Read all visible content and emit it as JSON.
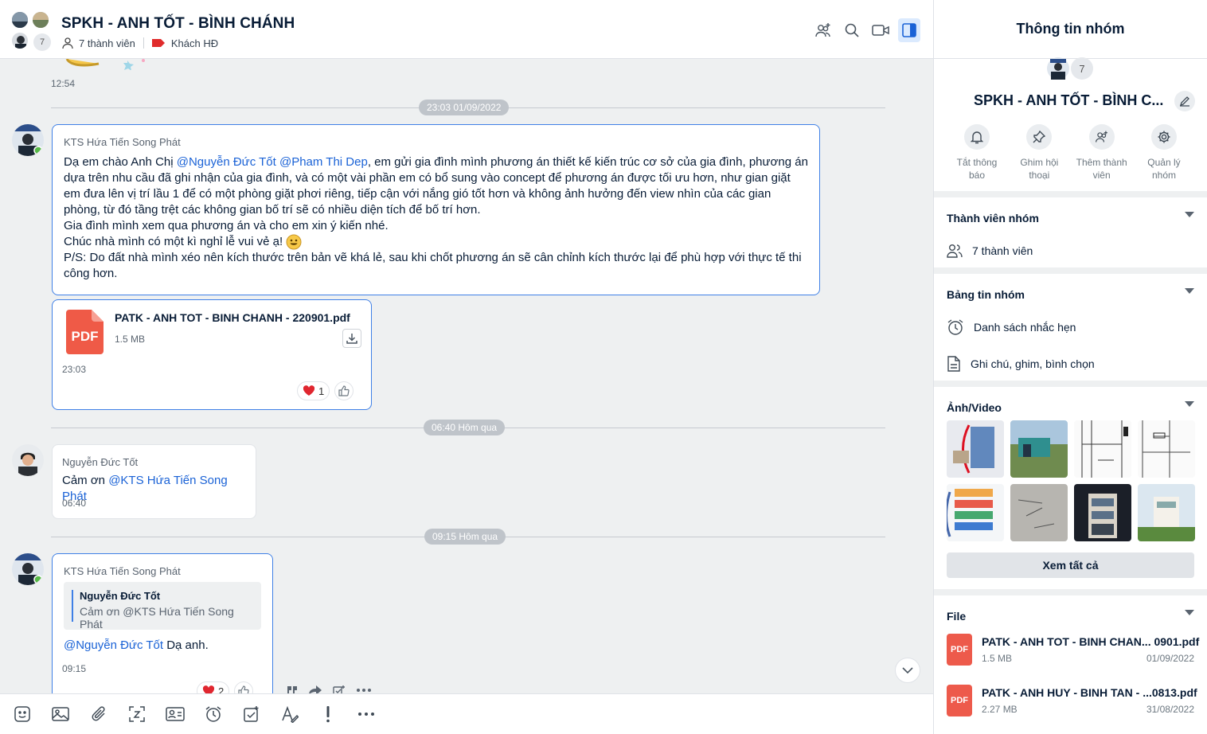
{
  "header": {
    "title": "SPKH - ANH TỐT - BÌNH CHÁNH",
    "member_count_badge": "7",
    "members_label": "7 thành viên",
    "tag_label": "Khách HĐ",
    "tag_color": "#e02b2b",
    "icons": [
      "add-member-icon",
      "search-icon",
      "video-call-icon",
      "toggle-info-panel-icon"
    ]
  },
  "chat": {
    "prev_message_time": "12:54",
    "messages": [
      {
        "separator": "23:03 01/09/2022",
        "sender": "KTS Hứa Tiến Song Phát",
        "text_intro": "Dạ em chào Anh Chị ",
        "mention1": "@Nguyễn Đức Tốt",
        "mention2": "@Pham Thi Dep",
        "text_body": ", em gửi gia đình mình phương án thiết kế kiến trúc cơ sở của gia đình, phương án dựa trên nhu cầu đã ghi nhận của gia đình, và có một vài phần em có bổ sung vào concept để phương án được tối ưu hơn, như gian giặt em đưa lên vị trí lầu 1 để có một phòng giặt phơi riêng, tiếp cận với nắng gió tốt hơn và không ảnh hưởng đến view nhìn của các gian phòng, từ đó tầng trệt các không gian bố trí sẽ có nhiều diện tích để bố trí hơn.",
        "line2": "Gia đình mình xem qua phương án và cho em xin ý kiến nhé.",
        "line3": "Chúc nhà mình có một kì nghỉ lễ vui vẻ ạ! ",
        "line4": "P/S: Do đất nhà mình xéo nên kích thước trên bản vẽ khá lẻ, sau khi chốt phương án sẽ cân chỉnh kích thước lại để phù hợp với thực tế thi công hơn."
      },
      {
        "file_icon_label": "PDF",
        "file_name": "PATK - ANH TOT - BINH CHANH - 220901.pdf",
        "file_size": "1.5 MB",
        "time": "23:03",
        "reaction_count": "1"
      },
      {
        "separator": "06:40 Hôm qua",
        "sender": "Nguyễn Đức Tốt",
        "text": "Cảm ơn ",
        "mention": "@KTS Hứa Tiến Song Phát",
        "time": "06:40"
      },
      {
        "separator": "09:15 Hôm qua",
        "sender": "KTS Hứa Tiến Song Phát",
        "quote_author": "Nguyễn Đức Tốt",
        "quote_text": "Cảm ơn @KTS Hứa Tiến Song Phát",
        "mention": "@Nguyễn Đức Tốt",
        "text": " Dạ anh.",
        "time": "09:15",
        "reaction_count": "2"
      }
    ]
  },
  "composer": {
    "tools": [
      "sticker-icon",
      "image-icon",
      "attach-icon",
      "screenshot-icon",
      "contact-card-icon",
      "reminder-icon",
      "task-icon",
      "format-icon",
      "urgent-icon",
      "more-icon"
    ]
  },
  "panel": {
    "title": "Thông tin nhóm",
    "group_name": "SPKH - ANH TỐT - BÌNH C...",
    "avatar_badge": "7",
    "actions": [
      {
        "label": "Tắt thông báo",
        "icon": "bell-icon"
      },
      {
        "label": "Ghim hội thoại",
        "icon": "pin-icon"
      },
      {
        "label": "Thêm thành viên",
        "icon": "add-member-icon"
      },
      {
        "label": "Quản lý nhóm",
        "icon": "gear-icon"
      }
    ],
    "members_section": {
      "title": "Thành viên nhóm",
      "row": "7 thành viên"
    },
    "board_section": {
      "title": "Bảng tin nhóm",
      "row1": "Danh sách nhắc hẹn",
      "row2": "Ghi chú, ghim, bình chọn"
    },
    "media_section": {
      "title": "Ảnh/Video",
      "see_all": "Xem tất cả"
    },
    "file_section": {
      "title": "File",
      "files": [
        {
          "icon_label": "PDF",
          "name": "PATK - ANH TOT - BINH CHAN... 0901.pdf",
          "size": "1.5 MB",
          "date": "01/09/2022"
        },
        {
          "icon_label": "PDF",
          "name": "PATK - ANH HUY - BINH TAN - ...0813.pdf",
          "size": "2.27 MB",
          "date": "31/08/2022"
        }
      ]
    }
  }
}
